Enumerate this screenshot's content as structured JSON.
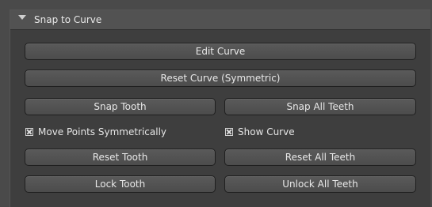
{
  "panel": {
    "title": "Snap to Curve",
    "collapse_icon": "triangle-down-icon"
  },
  "buttons": {
    "edit_curve": "Edit Curve",
    "reset_curve_symmetric": "Reset Curve (Symmetric)",
    "snap_tooth": "Snap Tooth",
    "snap_all_teeth": "Snap All Teeth",
    "reset_tooth": "Reset Tooth",
    "reset_all_teeth": "Reset All Teeth",
    "lock_tooth": "Lock Tooth",
    "unlock_all_teeth": "Unlock All Teeth"
  },
  "checkboxes": {
    "move_points_symmetrically": {
      "label": "Move Points Symmetrically",
      "checked": true
    },
    "show_curve": {
      "label": "Show Curve",
      "checked": true
    }
  }
}
